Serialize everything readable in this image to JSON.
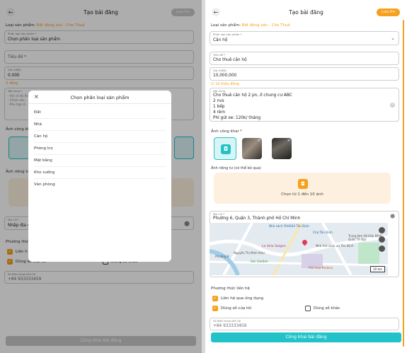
{
  "header": {
    "title": "Tạo bài đăng",
    "post_label": "Lưu tin"
  },
  "left": {
    "category_label": "Loại sản phẩm:",
    "category_value": "Bất động sản - Cho Thuê",
    "fields": {
      "product_type_small": "Phân loại sản phẩm *",
      "product_type_value": "Chọn phân loại sản phẩm",
      "title_value": "Tiêu đề *",
      "price_small": "Giá (VNĐ)",
      "price_value": "0.000",
      "price_hint": "0 đồng",
      "content_small": "Nội dung *",
      "content_lines": [
        "- Khi có đủ thông tin...",
        "- Chính xác...",
        "- Phù hợp đ..."
      ],
      "address_small": "Địa chỉ *",
      "address_value": "Nhập địa c"
    },
    "sections": {
      "public_images": "Ảnh công kh",
      "private_images": "Ảnh riêng tư",
      "contact": "Phương thức"
    },
    "contact_opts": [
      "Liên h",
      "Dùng số của tôi",
      "Dùng số khác"
    ],
    "phone_small": "Số điện thoại liên hệ",
    "phone_value": "+84 933333459",
    "submit_label": "Công khai bài đăng"
  },
  "modal": {
    "title": "Chọn phân loại sản phẩm",
    "options": [
      "Đất",
      "Nhà",
      "Căn hộ",
      "Phòng trọ",
      "Mặt bằng",
      "Kho xưởng",
      "Văn phòng"
    ]
  },
  "right": {
    "category_label": "Loại sản phẩm:",
    "category_value": "Bất động sản - Cho Thuê",
    "product_type_small": "Phân loại sản phẩm *",
    "product_type_value": "Căn hộ",
    "title_small": "Tiêu đề *",
    "title_value": "Cho thuê căn hộ",
    "price_small": "Giá (VNĐ)",
    "price_value": "10,000,000",
    "price_hint": "10 triệu đồng",
    "content_small": "Nội dung",
    "content_lines": [
      "Cho thuê căn hộ 2 pn, ở chung cư ABC",
      "2 nvs",
      "1 bếp",
      "4 rèm",
      "Phí gửi xe: 120k/ tháng"
    ],
    "public_images_label": "Ảnh công khai *",
    "private_images_label": "Ảnh riêng tư (có thể bỏ qua)",
    "upload_text": "Chọn từ 1 đến 10 ảnh",
    "address_small": "Địa chỉ *",
    "address_value": "Phường 6, Quận 3, Thành phố Hồ Chí Minh",
    "map_labels": {
      "fahasa": "Nhà sách FAHASA Tân Định",
      "market": "Chợ Tân Định",
      "venue": "La Vela Saigon",
      "giao": "Nhà thờ Giáo xứ Tân Định",
      "garden": "Sen Garden",
      "hospital": "Trung tâm Hô Hấp Bệnh Quốc Tế (Ký)",
      "paris": "Phở Hoa Pasteur",
      "road": "Nguyễn Thị Minh Khai",
      "ward": "Phường 8",
      "scale": "10 km"
    },
    "contact_label": "Phương thức liên hệ",
    "contact_opts": [
      "Liên hệ qua ứng dụng",
      "Dùng số của tôi",
      "Dùng số khác"
    ],
    "phone_small": "Số điện thoại liên hệ",
    "phone_value": "+84 933333459",
    "submit_label": "Công khai bài đăng"
  },
  "colors": {
    "accent": "#f7a01d",
    "teal": "#21c3c9"
  },
  "icons": [
    "back-arrow-icon",
    "close-icon",
    "chevron-down-icon",
    "camera-icon",
    "upload-icon",
    "location-pin-icon",
    "check-icon",
    "clear-icon"
  ]
}
